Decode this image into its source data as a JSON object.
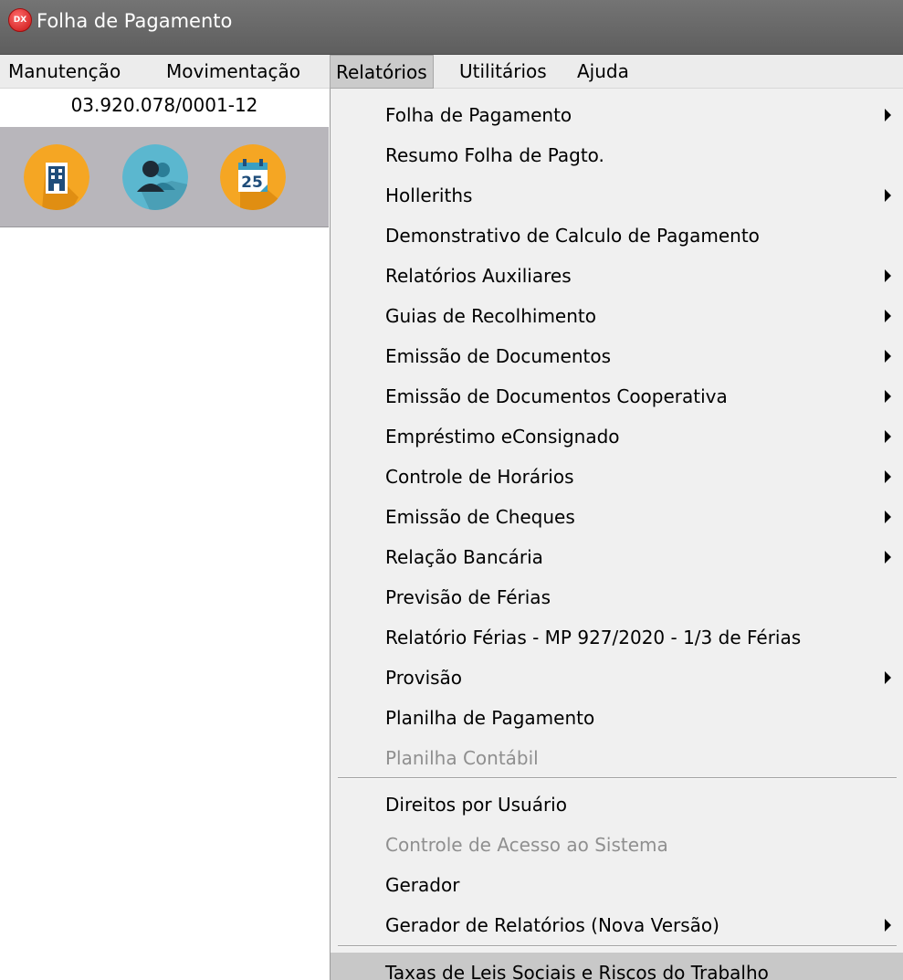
{
  "window": {
    "title": "Folha de Pagamento",
    "icon": "dx-app-icon",
    "icon_text": "DX"
  },
  "menubar": [
    {
      "label": "Manutenção"
    },
    {
      "label": "Movimentação"
    },
    {
      "label": "Relatórios",
      "active": true
    },
    {
      "label": "Utilitários"
    },
    {
      "label": "Ajuda"
    }
  ],
  "company": {
    "cnpj": "03.920.078/0001-12"
  },
  "toolbar": [
    {
      "icon": "building-icon",
      "color": "#f5a623"
    },
    {
      "icon": "users-icon",
      "color": "#5bb7cf"
    },
    {
      "icon": "calendar-icon",
      "color": "#f5a623",
      "text": "25"
    }
  ],
  "menu": {
    "items": [
      {
        "label": "Folha de Pagamento",
        "submenu": true
      },
      {
        "label": "Resumo Folha de Pagto.",
        "submenu": false
      },
      {
        "label": "Holleriths",
        "submenu": true
      },
      {
        "label": "Demonstrativo de Calculo de Pagamento",
        "submenu": false
      },
      {
        "label": "Relatórios Auxiliares",
        "submenu": true
      },
      {
        "label": "Guias de Recolhimento",
        "submenu": true
      },
      {
        "label": "Emissão de Documentos",
        "submenu": true
      },
      {
        "label": "Emissão de Documentos Cooperativa",
        "submenu": true
      },
      {
        "label": "Empréstimo eConsignado",
        "submenu": true
      },
      {
        "label": "Controle de Horários",
        "submenu": true
      },
      {
        "label": "Emissão de Cheques",
        "submenu": true
      },
      {
        "label": "Relação Bancária",
        "submenu": true
      },
      {
        "label": "Previsão de Férias",
        "submenu": false
      },
      {
        "label": "Relatório Férias - MP 927/2020 - 1/3 de Férias",
        "submenu": false
      },
      {
        "label": "Provisão",
        "submenu": true
      },
      {
        "label": "Planilha de Pagamento",
        "submenu": false
      },
      {
        "label": "Planilha Contábil",
        "submenu": false,
        "disabled": true
      },
      {
        "label": "Direitos por Usuário",
        "submenu": false
      },
      {
        "label": "Controle de Acesso ao Sistema",
        "submenu": false,
        "disabled": true
      },
      {
        "label": "Gerador",
        "submenu": false
      },
      {
        "label": "Gerador de Relatórios (Nova Versão)",
        "submenu": true
      },
      {
        "label": "Taxas de Leis Sociais e Riscos do Trabalho",
        "submenu": false,
        "highlighted": true
      }
    ]
  },
  "colors": {
    "titlebar": "#6a6a6a",
    "menubar": "#ececec",
    "menu_background": "#f0f0f0",
    "toolbar_background": "#b8b6bb",
    "disabled_text": "#8f8f8f",
    "highlight": "#c8c8c8"
  }
}
